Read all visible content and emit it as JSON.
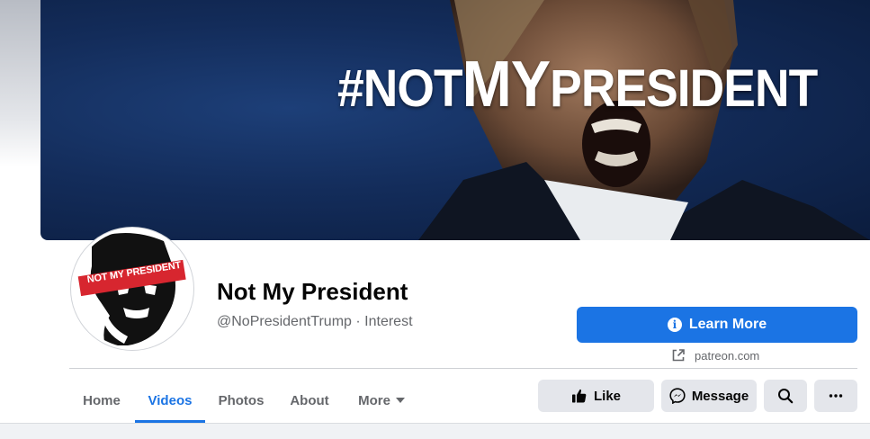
{
  "cover": {
    "text_prefix": "#NOT",
    "text_emphasis": "MY",
    "text_suffix": "PRESIDENT"
  },
  "avatar": {
    "banner_text": "NOT MY PRESIDENT",
    "banner_color": "#d7262f"
  },
  "page": {
    "name": "Not My President",
    "handle": "@NoPresidentTrump",
    "separator": "·",
    "category": "Interest"
  },
  "cta": {
    "label": "Learn More",
    "icon": "info-icon",
    "link_text": "patreon.com",
    "link_icon": "external-link-icon"
  },
  "tabs": [
    {
      "label": "Home",
      "active": false
    },
    {
      "label": "Videos",
      "active": true
    },
    {
      "label": "Photos",
      "active": false
    },
    {
      "label": "About",
      "active": false
    },
    {
      "label": "More",
      "active": false,
      "icon": "caret-down-icon"
    }
  ],
  "actions": {
    "like_label": "Like",
    "like_icon": "thumbs-up-icon",
    "message_label": "Message",
    "message_icon": "messenger-icon",
    "search_icon": "search-icon",
    "more_icon": "ellipsis-icon"
  },
  "colors": {
    "accent": "#1b74e4",
    "button_gray": "#e4e6eb",
    "secondary_text": "#65676b"
  }
}
